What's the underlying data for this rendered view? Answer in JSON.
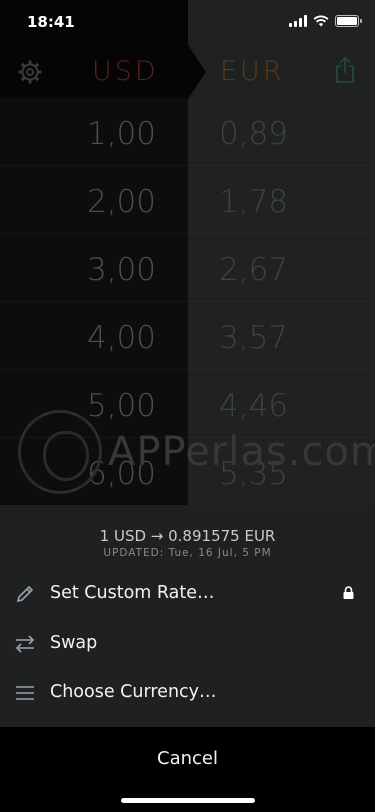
{
  "status_bar": {
    "time": "18:41"
  },
  "converter": {
    "from_currency": "USD",
    "to_currency": "EUR",
    "rows": [
      {
        "from": "1,00",
        "to": "0,89"
      },
      {
        "from": "2,00",
        "to": "1,78"
      },
      {
        "from": "3,00",
        "to": "2,67"
      },
      {
        "from": "4,00",
        "to": "3,57"
      },
      {
        "from": "5,00",
        "to": "4,46"
      },
      {
        "from": "6,00",
        "to": "5,35"
      }
    ],
    "accent_colors": {
      "from": "#5a2020",
      "to": "#5a3a1e"
    }
  },
  "watermark": {
    "text": "APPerlas.com"
  },
  "sheet": {
    "rate_text": "1 USD → 0.891575 EUR",
    "updated_label": "UPDATED:",
    "updated_value": "Tue, 16 Jul, 5 PM",
    "actions": [
      {
        "label": "Set Custom Rate…",
        "icon": "pencil-icon",
        "locked": true
      },
      {
        "label": "Swap",
        "icon": "swap-arrows-icon"
      },
      {
        "label": "Choose Currency…",
        "icon": "list-icon"
      }
    ],
    "cancel_label": "Cancel"
  }
}
